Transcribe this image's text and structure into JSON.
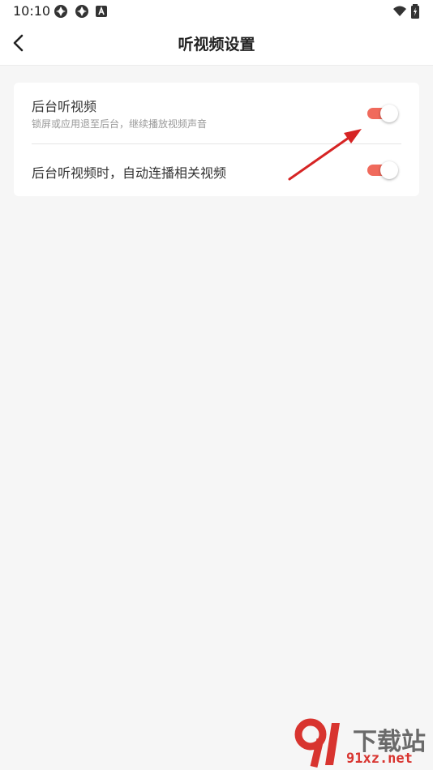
{
  "status_bar": {
    "time": "10:10",
    "icons": [
      "aperture-icon",
      "aperture-icon",
      "a-badge-icon",
      "wifi-icon",
      "battery-icon"
    ]
  },
  "header": {
    "title": "听视频设置",
    "back_icon": "chevron-left-icon"
  },
  "settings": {
    "background_listen": {
      "title": "后台听视频",
      "subtitle": "锁屏或应用退至后台，继续播放视频声音",
      "enabled": true
    },
    "auto_play_related": {
      "title": "后台听视频时，自动连播相关视频",
      "enabled": true
    }
  },
  "watermark": {
    "name": "下载站",
    "domain": "91xz.net"
  },
  "colors": {
    "toggle_on": "#f06a5c",
    "arrow": "#d62424",
    "background": "#f6f6f6",
    "watermark_red": "#d8342f"
  }
}
